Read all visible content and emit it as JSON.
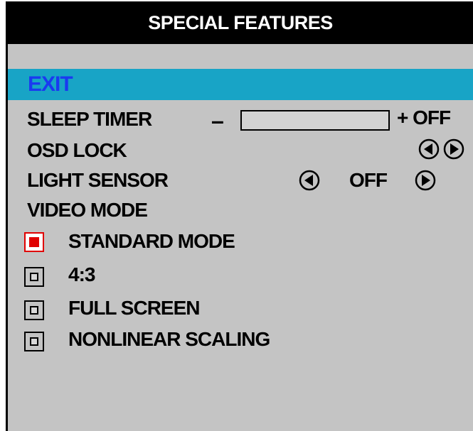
{
  "title": "SPECIAL FEATURES",
  "exit_label": "EXIT",
  "sleep_timer": {
    "label": "SLEEP TIMER",
    "decrease": "–",
    "increase_and_value": "+ OFF",
    "slider_fraction": 0
  },
  "osd_lock": {
    "label": "OSD LOCK"
  },
  "light_sensor": {
    "label": "LIGHT SENSOR",
    "value": "OFF"
  },
  "video_mode": {
    "label": "VIDEO MODE",
    "options": [
      {
        "label": "STANDARD MODE",
        "selected": true
      },
      {
        "label": "4:3",
        "selected": false
      },
      {
        "label": "FULL SCREEN",
        "selected": false
      },
      {
        "label": "NONLINEAR SCALING",
        "selected": false
      }
    ]
  },
  "colors": {
    "title_bg": "#000000",
    "panel_bg": "#c4c4c4",
    "highlight_bg": "#18a4c6",
    "highlight_text": "#1a3af0",
    "selected_check": "#e00000"
  },
  "icons": {
    "left_arrow": "circle-left-arrow-icon",
    "right_arrow": "circle-right-arrow-icon"
  }
}
